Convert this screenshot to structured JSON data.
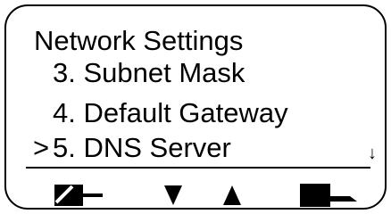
{
  "screen": {
    "title": "Network Settings",
    "cursor": ">",
    "more_indicator": "↓",
    "items": [
      {
        "label": "3. Subnet Mask"
      },
      {
        "label": "4. Default Gateway"
      },
      {
        "label": "5. DNS Server",
        "selected": true
      }
    ]
  },
  "softkeys": [
    {
      "icon": "back-icon"
    },
    {
      "icon": "down-arrow-icon"
    },
    {
      "icon": "up-arrow-icon"
    },
    {
      "icon": "enter-icon"
    }
  ]
}
